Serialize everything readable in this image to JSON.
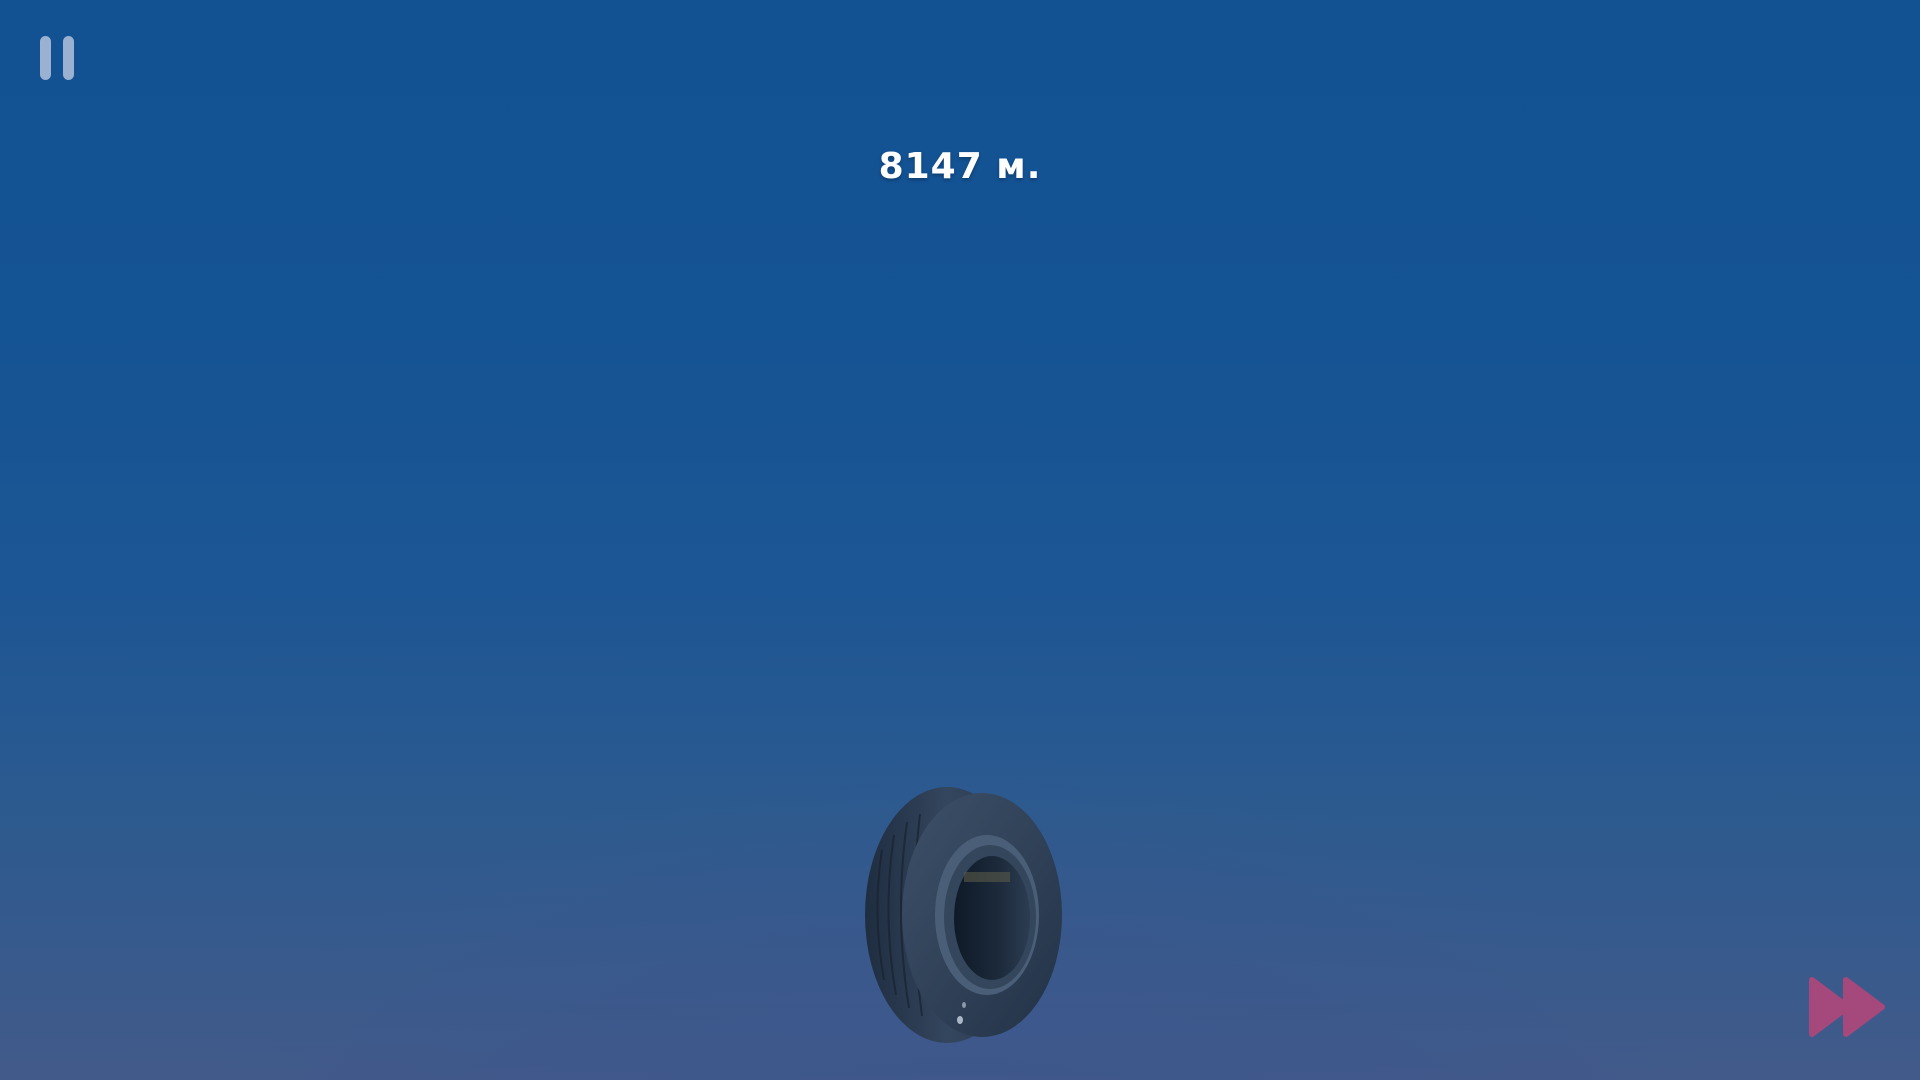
{
  "hud": {
    "distance_label": "8147 м.",
    "pause_icon": "pause-icon",
    "fast_forward_icon": "fast-forward-icon"
  },
  "scene": {
    "object": "tire",
    "sky_top_color": "#125192",
    "sky_bottom_color": "#425a8a"
  },
  "colors": {
    "pause_icon": "#c8d2e6",
    "fast_forward_icon": "#b8457a",
    "distance_text": "#ffffff"
  }
}
